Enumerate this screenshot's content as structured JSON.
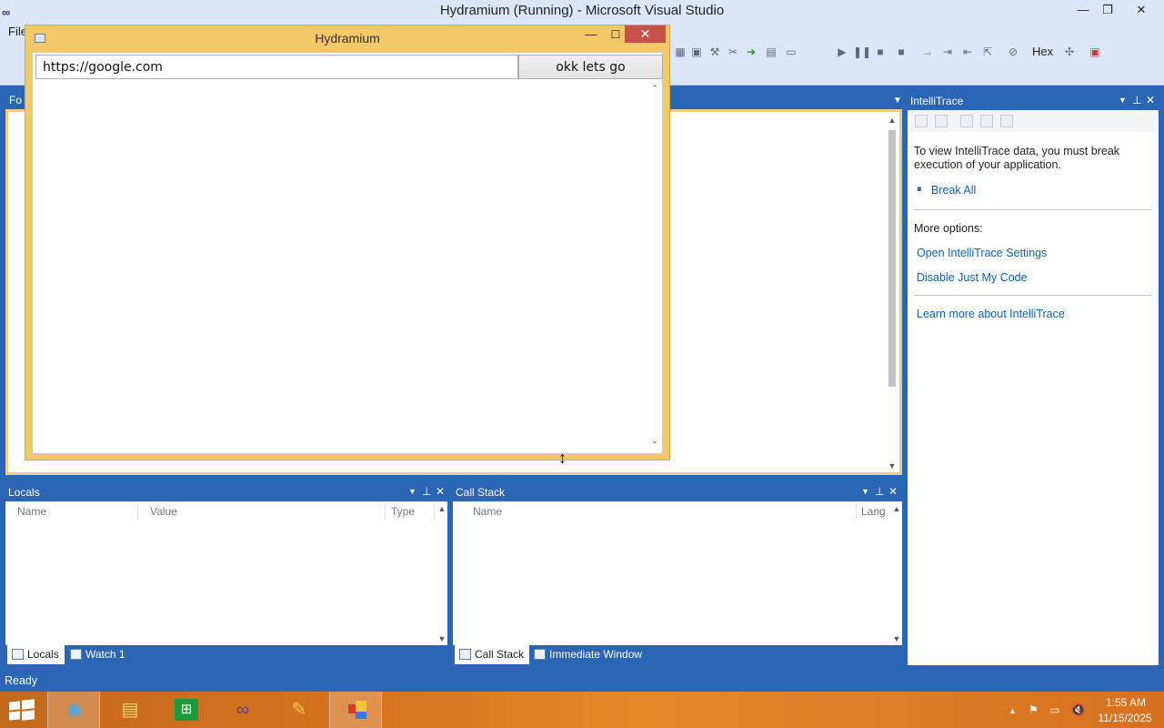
{
  "vs": {
    "title": "Hydramium (Running) - Microsoft Visual Studio",
    "menu_file": "File",
    "toolbar_hex": "Hex",
    "doc_tab_first": "Fo",
    "status": "Ready"
  },
  "hydramium": {
    "title": "Hydramium",
    "url_value": "https://google.com",
    "go_label": "okk lets go"
  },
  "locals": {
    "title": "Locals",
    "columns": [
      "Name",
      "Value",
      "Type"
    ],
    "tabs": [
      "Locals",
      "Watch 1"
    ]
  },
  "callstack": {
    "title": "Call Stack",
    "columns": [
      "Name",
      "Lang"
    ],
    "tabs": [
      "Call Stack",
      "Immediate Window"
    ]
  },
  "intellitrace": {
    "title": "IntelliTrace",
    "message": "To view IntelliTrace data, you must break execution of your application.",
    "break_all": "Break All",
    "more_options": "More options:",
    "open_settings": "Open IntelliTrace Settings",
    "disable_jmc": "Disable Just My Code",
    "learn_more": "Learn more about IntelliTrace"
  },
  "tray": {
    "time": "1:55 AM",
    "date": "11/15/2025"
  },
  "colors": {
    "vs_blue": "#2b65b5",
    "hydramium_frame": "#f4c767",
    "taskbar": "#d9751e",
    "close_red": "#c7504b",
    "link": "#0e62b3"
  },
  "icons": [
    "vs-logo-icon",
    "pin-icon",
    "close-icon",
    "dropdown-icon",
    "pause-icon",
    "windows-start-icon",
    "ie-icon",
    "file-explorer-icon",
    "store-icon",
    "visual-studio-icon",
    "paint-icon",
    "app-icon",
    "flag-icon",
    "network-icon",
    "volume-muted-icon",
    "resize-cursor-icon"
  ]
}
